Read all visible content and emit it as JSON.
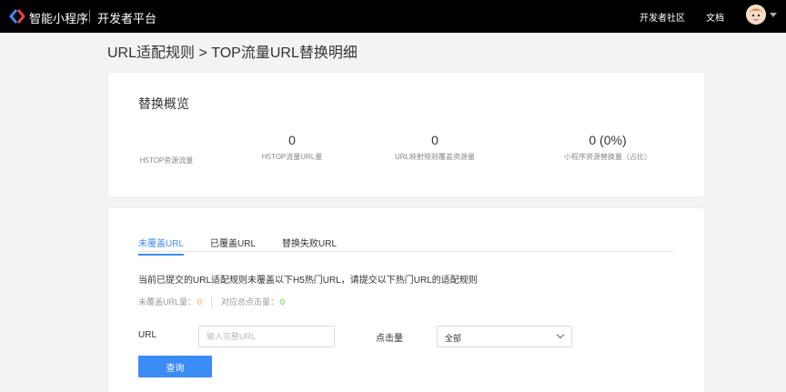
{
  "topbar": {
    "brand": "智能小程序",
    "platform": "开发者平台",
    "nav": {
      "community": "开发者社区",
      "docs": "文档"
    }
  },
  "page": {
    "title": "URL适配规则 > TOP流量URL替换明细"
  },
  "overview": {
    "title": "替换概览",
    "stats": [
      {
        "value": "",
        "label": "H5TOP资源流量"
      },
      {
        "value": "0",
        "label": "H5TOP流量URL量"
      },
      {
        "value": "0",
        "label": "URL映射规则覆盖资源量"
      },
      {
        "value": "0 (0%)",
        "label": "小程序资源替换量（占比）"
      }
    ]
  },
  "details": {
    "tabs": [
      {
        "label": "未覆盖URL",
        "active": true
      },
      {
        "label": "已覆盖URL",
        "active": false
      },
      {
        "label": "替换失败URL",
        "active": false
      }
    ],
    "notice": "当前已提交的URL适配规则未覆盖以下H5热门URL，请提交以下热门URL的适配规则",
    "counts": {
      "uncovered_label": "未覆盖URL量：",
      "uncovered_value": "0",
      "clicks_label": "对应总点击量：",
      "clicks_value": "0"
    },
    "filters": {
      "url_label": "URL",
      "url_placeholder": "输入完整URL",
      "url_value": "",
      "clicks_label": "点击量",
      "clicks_selected": "全部"
    },
    "query_button": "查询"
  },
  "colors": {
    "accent": "#3c8cf6",
    "orange": "#f5a623",
    "green": "#52c41a",
    "topbar": "#000000"
  }
}
